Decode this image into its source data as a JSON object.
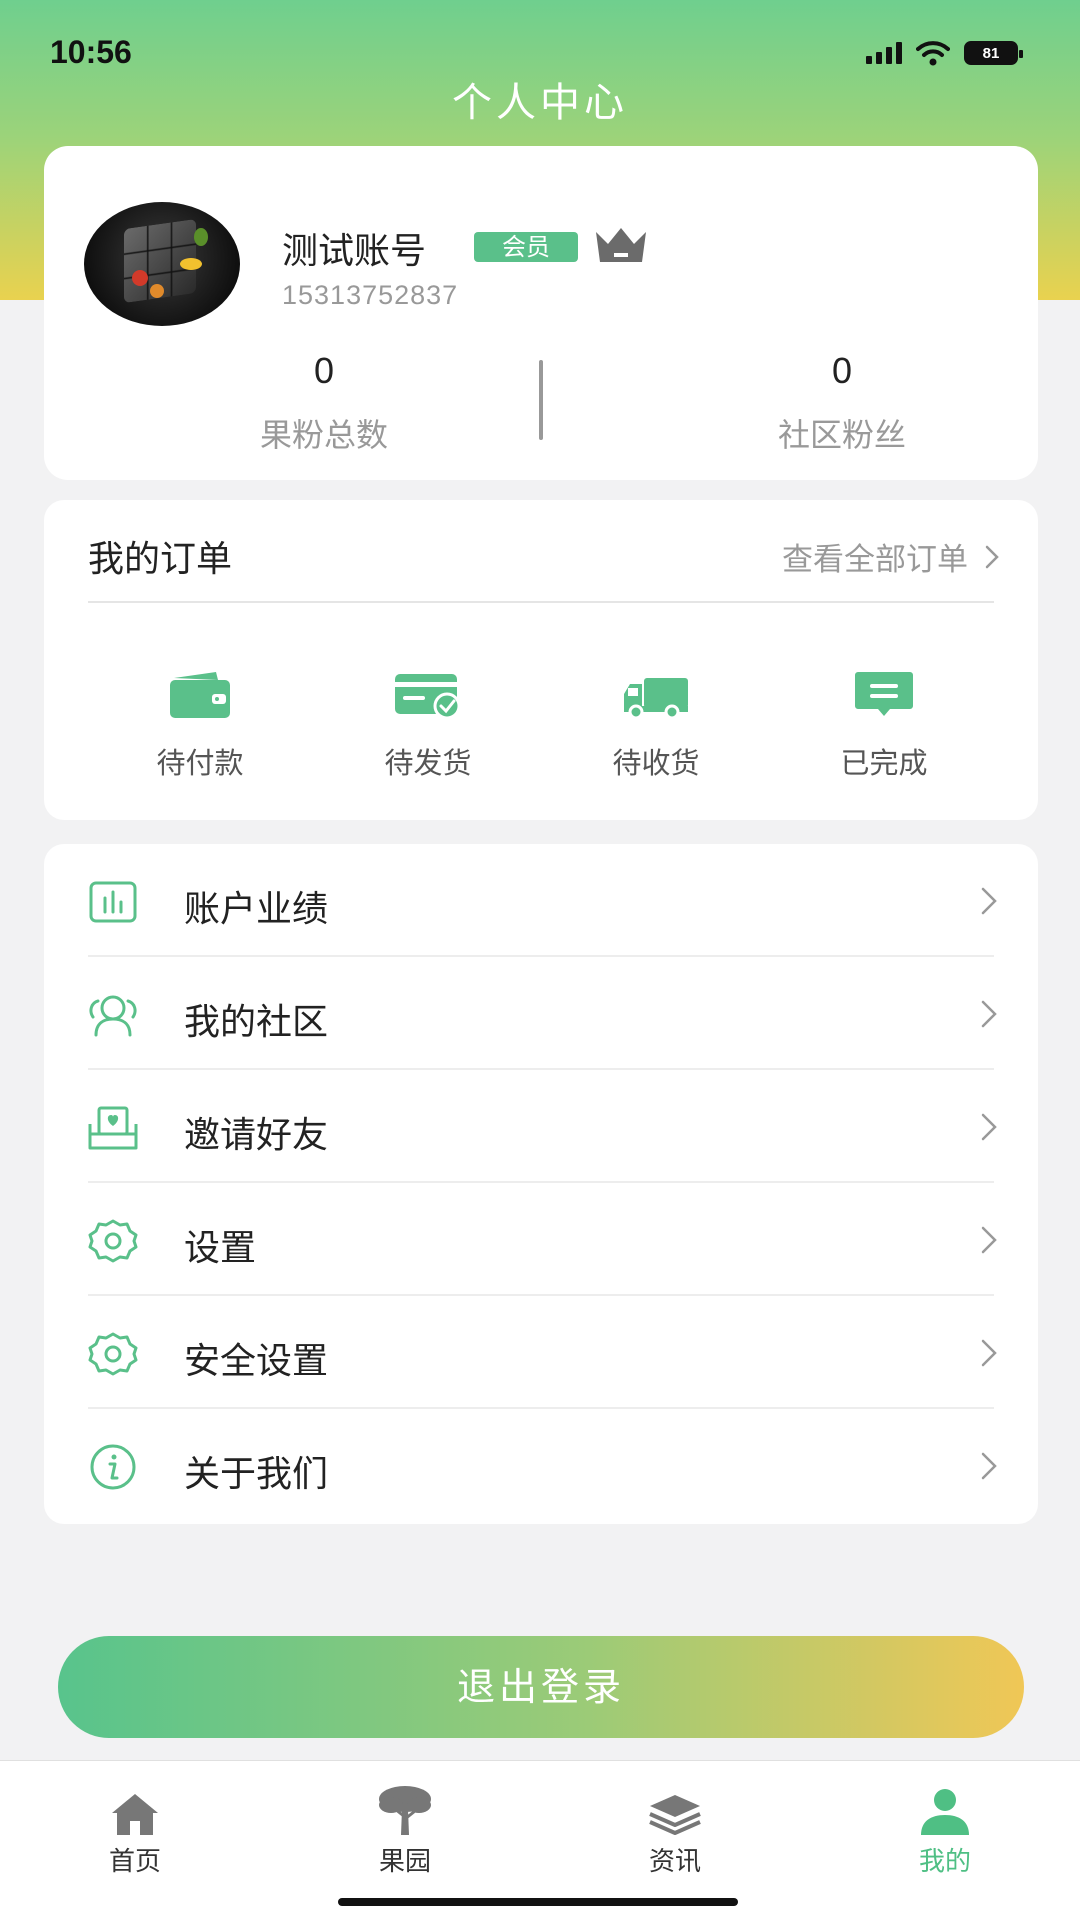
{
  "status_bar": {
    "time": "10:56",
    "battery": "81"
  },
  "page": {
    "title": "个人中心"
  },
  "profile": {
    "name": "测试账号",
    "badge": "会员",
    "phone": "15313752837",
    "stats": [
      {
        "value": "0",
        "label": "果粉总数"
      },
      {
        "value": "0",
        "label": "社区粉丝"
      }
    ]
  },
  "orders": {
    "title": "我的订单",
    "view_all": "查看全部订单",
    "statuses": [
      {
        "label": "待付款",
        "icon": "wallet-icon"
      },
      {
        "label": "待发货",
        "icon": "card-check-icon"
      },
      {
        "label": "待收货",
        "icon": "truck-icon"
      },
      {
        "label": "已完成",
        "icon": "message-icon"
      }
    ]
  },
  "menu": {
    "items": [
      {
        "label": "账户业绩",
        "icon": "chart-icon"
      },
      {
        "label": "我的社区",
        "icon": "community-icon"
      },
      {
        "label": "邀请好友",
        "icon": "invite-icon"
      },
      {
        "label": "设置",
        "icon": "gear-icon"
      },
      {
        "label": "安全设置",
        "icon": "gear-icon"
      },
      {
        "label": "关于我们",
        "icon": "info-icon"
      }
    ]
  },
  "logout": {
    "label": "退出登录"
  },
  "tabs": [
    {
      "label": "首页",
      "icon": "home-icon",
      "active": false
    },
    {
      "label": "果园",
      "icon": "tree-icon",
      "active": false
    },
    {
      "label": "资讯",
      "icon": "layers-icon",
      "active": false
    },
    {
      "label": "我的",
      "icon": "user-icon",
      "active": true
    }
  ],
  "colors": {
    "accent": "#4fbf84",
    "header_top": "#6fcf8e",
    "header_bottom": "#e9d24f",
    "logout_start": "#58c48c",
    "logout_end": "#f0c756"
  }
}
